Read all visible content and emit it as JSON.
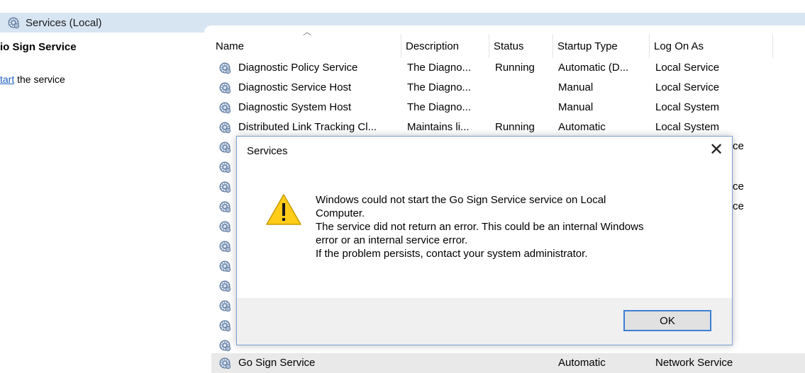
{
  "header": {
    "title": "Services (Local)"
  },
  "left_pane": {
    "service_name": "io Sign Service",
    "action_link": "tart",
    "action_suffix": " the service"
  },
  "columns": {
    "name": "Name",
    "description": "Description",
    "status": "Status",
    "startup_type": "Startup Type",
    "log_on_as": "Log On As"
  },
  "rows": [
    {
      "name": "Diagnostic Policy Service",
      "description": "The Diagno...",
      "status": "Running",
      "startup": "Automatic (D...",
      "logon": "Local Service"
    },
    {
      "name": "Diagnostic Service Host",
      "description": "The Diagno...",
      "status": "",
      "startup": "Manual",
      "logon": "Local Service"
    },
    {
      "name": "Diagnostic System Host",
      "description": "The Diagno...",
      "status": "",
      "startup": "Manual",
      "logon": "Local System"
    },
    {
      "name": "Distributed Link Tracking Cl...",
      "description": "Maintains li...",
      "status": "Running",
      "startup": "Automatic",
      "logon": "Local System"
    }
  ],
  "peek_text": [
    "ce",
    "ce",
    "ce"
  ],
  "selected_row": {
    "name": "Go Sign Service",
    "startup": "Automatic",
    "logon": "Network Service"
  },
  "dialog": {
    "title": "Services",
    "close_glyph": "✕",
    "message_lines": [
      "Windows could not start the Go Sign Service service on Local",
      "Computer.",
      "The service did not return an error.  This could be an internal Windows",
      "error or an internal service error.",
      "If the problem persists, contact your system administrator."
    ],
    "ok_label": "OK"
  },
  "colors": {
    "header_bar": "#d7e5f3",
    "link": "#1f5fbf",
    "button_border": "#3c7fd3",
    "warning": "#ffcc1a"
  }
}
